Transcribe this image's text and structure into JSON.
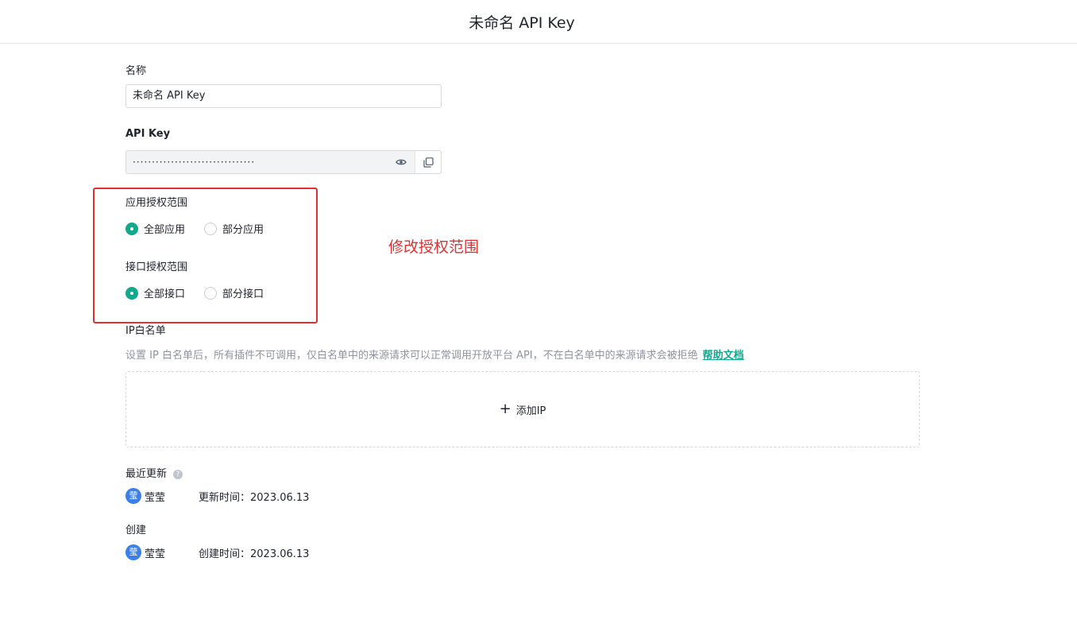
{
  "header": {
    "title": "未命名 API Key"
  },
  "name_field": {
    "label": "名称",
    "value": "未命名 API Key"
  },
  "api_key_field": {
    "label": "API Key",
    "masked_value": "································"
  },
  "app_scope": {
    "label": "应用授权范围",
    "options": [
      {
        "label": "全部应用",
        "checked": true
      },
      {
        "label": "部分应用",
        "checked": false
      }
    ]
  },
  "api_scope": {
    "label": "接口授权范围",
    "options": [
      {
        "label": "全部接口",
        "checked": true
      },
      {
        "label": "部分接口",
        "checked": false
      }
    ]
  },
  "annotation": {
    "text": "修改授权范围",
    "color": "#e03131"
  },
  "ip_whitelist": {
    "label": "IP白名单",
    "description": "设置 IP 白名单后，所有插件不可调用，仅白名单中的来源请求可以正常调用开放平台 API，不在白名单中的来源请求会被拒绝",
    "help_link": "帮助文档",
    "add_button": "添加IP"
  },
  "recent_update": {
    "label": "最近更新",
    "avatar_char": "莹",
    "user": "莹莹",
    "time_text": "更新时间：2023.06.13"
  },
  "created": {
    "label": "创建",
    "avatar_char": "莹",
    "user": "莹莹",
    "time_text": "创建时间：2023.06.13"
  },
  "colors": {
    "accent": "#12a88e",
    "avatar": "#3c7fe6",
    "highlight": "#e03131"
  }
}
